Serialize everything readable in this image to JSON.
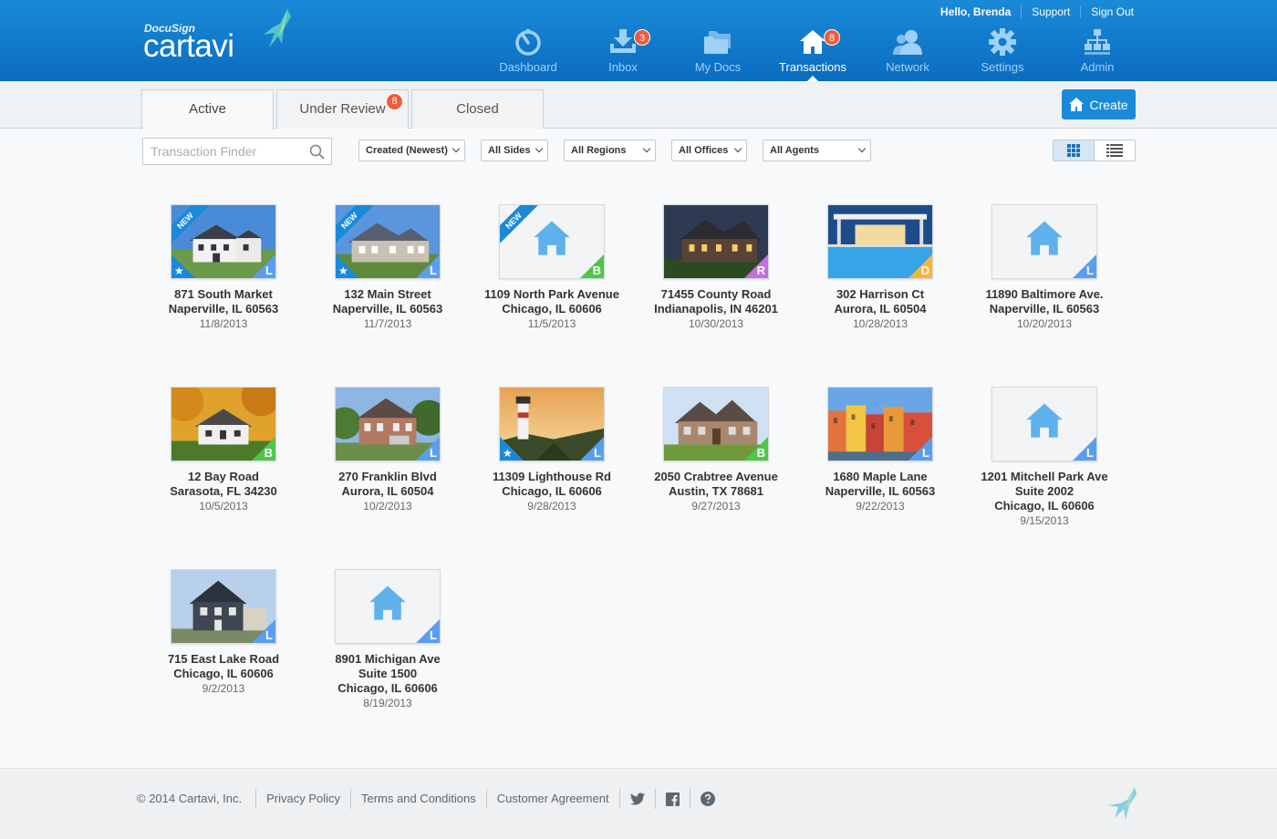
{
  "brand": {
    "docusign": "DocuSign",
    "name": "cartavi"
  },
  "top_links": {
    "greeting": "Hello, Brenda",
    "support": "Support",
    "signout": "Sign Out"
  },
  "nav": [
    {
      "label": "Dashboard",
      "icon": "dashboard-icon"
    },
    {
      "label": "Inbox",
      "icon": "inbox-icon",
      "badge": "3"
    },
    {
      "label": "My Docs",
      "icon": "folders-icon"
    },
    {
      "label": "Transactions",
      "icon": "house-icon",
      "badge": "8",
      "active": true
    },
    {
      "label": "Network",
      "icon": "people-icon"
    },
    {
      "label": "Settings",
      "icon": "gear-icon"
    },
    {
      "label": "Admin",
      "icon": "org-chart-icon"
    }
  ],
  "tabs": [
    {
      "label": "Active",
      "active": true
    },
    {
      "label": "Under Review",
      "badge": "8"
    },
    {
      "label": "Closed"
    }
  ],
  "create_label": "Create",
  "finder_placeholder": "Transaction Finder",
  "filters": {
    "sort": "Created (Newest)",
    "sides": "All Sides",
    "regions": "All Regions",
    "offices": "All Offices",
    "agents": "All Agents"
  },
  "transactions": [
    {
      "l1": "871 South Market",
      "l2": "Naperville, IL 60563",
      "l3": "",
      "date": "11/8/2013",
      "role": "L",
      "new": true,
      "star": true,
      "photo": "house-white"
    },
    {
      "l1": "132 Main Street",
      "l2": "Naperville, IL 60563",
      "l3": "",
      "date": "11/7/2013",
      "role": "L",
      "new": true,
      "star": true,
      "photo": "house-grey"
    },
    {
      "l1": "1109 North Park Avenue",
      "l2": "Chicago, IL 60606",
      "l3": "",
      "date": "11/5/2013",
      "role": "B",
      "new": true,
      "star": false,
      "photo": "placeholder"
    },
    {
      "l1": "71455 County Road",
      "l2": "Indianapolis, IN 46201",
      "l3": "",
      "date": "10/30/2013",
      "role": "R",
      "new": false,
      "star": false,
      "photo": "house-night"
    },
    {
      "l1": "302 Harrison Ct",
      "l2": "Aurora, IL 60504",
      "l3": "",
      "date": "10/28/2013",
      "role": "D",
      "new": false,
      "star": false,
      "photo": "pool"
    },
    {
      "l1": "11890 Baltimore Ave.",
      "l2": "Naperville, IL 60563",
      "l3": "",
      "date": "10/20/2013",
      "role": "L",
      "new": false,
      "star": false,
      "photo": "placeholder"
    },
    {
      "l1": "12 Bay Road",
      "l2": "Sarasota, FL 34230",
      "l3": "",
      "date": "10/5/2013",
      "role": "B",
      "new": false,
      "star": false,
      "photo": "house-autumn"
    },
    {
      "l1": "270 Franklin Blvd",
      "l2": "Aurora, IL 60504",
      "l3": "",
      "date": "10/2/2013",
      "role": "L",
      "new": false,
      "star": false,
      "photo": "house-brick"
    },
    {
      "l1": "11309 Lighthouse Rd",
      "l2": "Chicago, IL 60606",
      "l3": "",
      "date": "9/28/2013",
      "role": "L",
      "new": false,
      "star": true,
      "photo": "lighthouse"
    },
    {
      "l1": "2050 Crabtree Avenue",
      "l2": "Austin, TX 78681",
      "l3": "",
      "date": "9/27/2013",
      "role": "B",
      "new": false,
      "star": false,
      "photo": "house-stone"
    },
    {
      "l1": "1680 Maple Lane",
      "l2": "Naperville, IL 60563",
      "l3": "",
      "date": "9/22/2013",
      "role": "L",
      "new": false,
      "star": false,
      "photo": "colorful"
    },
    {
      "l1": "1201 Mitchell Park Ave",
      "l2": "Suite 2002",
      "l3": "Chicago, IL 60606",
      "date": "9/15/2013",
      "role": "L",
      "new": false,
      "star": false,
      "photo": "placeholder"
    },
    {
      "l1": "715 East Lake Road",
      "l2": "Chicago, IL 60606",
      "l3": "",
      "date": "9/2/2013",
      "role": "L",
      "new": false,
      "star": false,
      "photo": "house-dark"
    },
    {
      "l1": "8901 Michigan Ave",
      "l2": "Suite 1500",
      "l3": "Chicago, IL 60606",
      "date": "8/19/2013",
      "role": "L",
      "new": false,
      "star": false,
      "photo": "placeholder"
    }
  ],
  "role_colors": {
    "L": "#5b9ef0",
    "B": "#4fc54a",
    "R": "#c26fe0",
    "D": "#f5b53a"
  },
  "new_label": "NEW",
  "footer": {
    "copyright": "© 2014 Cartavi, Inc.",
    "privacy": "Privacy Policy",
    "terms": "Terms and Conditions",
    "agreement": "Customer Agreement"
  }
}
